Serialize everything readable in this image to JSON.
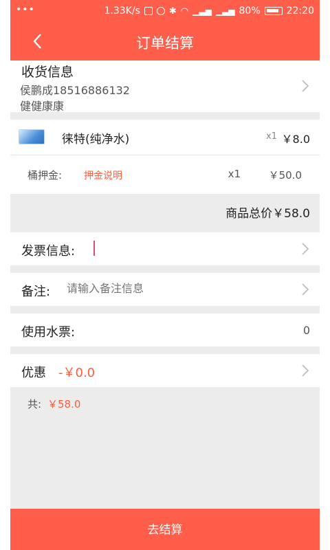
{
  "status_bar": {
    "speed": "1.33K/s",
    "battery": "80%",
    "time": "22:20"
  },
  "header": {
    "title": "订单结算"
  },
  "address": {
    "heading": "收货信息",
    "name_phone": "侯鹏成18516886132",
    "detail": "健健康康"
  },
  "product": {
    "name": "徕特(纯净水)",
    "qty": "x1",
    "price": "￥8.0"
  },
  "deposit": {
    "label": "桶押金:",
    "note": "押金说明",
    "qty": "x1",
    "price": "￥50.0"
  },
  "goods_total": "商品总价￥58.0",
  "invoice": {
    "label": "发票信息:"
  },
  "memo": {
    "label": "备注:",
    "placeholder": "请输入备注信息"
  },
  "water_ticket": {
    "label": "使用水票:",
    "value": "0"
  },
  "discount": {
    "label": "优惠",
    "value": "-￥0.0"
  },
  "grand_total": {
    "label": "共:",
    "value": "￥58.0"
  },
  "checkout_label": "去结算",
  "colors": {
    "accent": "#ff5f4a",
    "price_red": "#ff5a3c",
    "background": "#ececec"
  }
}
